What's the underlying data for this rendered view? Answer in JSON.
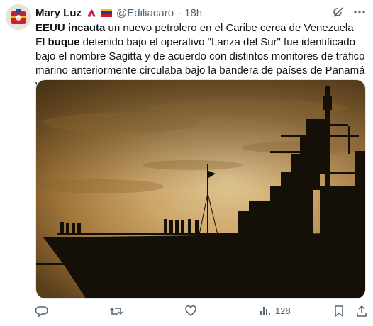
{
  "author": {
    "name": "Mary Luz",
    "handle": "@Ediliacaro",
    "separator": "·",
    "time": "18h"
  },
  "tweet": {
    "line1_bold": "EEUU incauta",
    "line1_rest": " un nuevo petrolero en el Caribe cerca de Venezuela",
    "line2_pre": "El ",
    "line2_bold": "buque",
    "line2_rest": " detenido bajo el operativo \"Lanza del Sur\" fue identificado bajo el nombre Sagitta y de acuerdo con distintos monitores de tráfico marino anteriormente circulaba bajo la bandera de países de Panamá y Liberia"
  },
  "stats": {
    "views": "128"
  },
  "icons": {
    "grok": "grok-icon",
    "more": "more-icon",
    "reply": "reply-icon",
    "retweet": "retweet-icon",
    "like": "like-icon",
    "views": "views-icon",
    "bookmark": "bookmark-icon",
    "share": "share-icon"
  },
  "colors": {
    "text": "#0f1419",
    "secondary": "#536471",
    "sky": "#c9a15d",
    "silhouette": "#141008"
  }
}
